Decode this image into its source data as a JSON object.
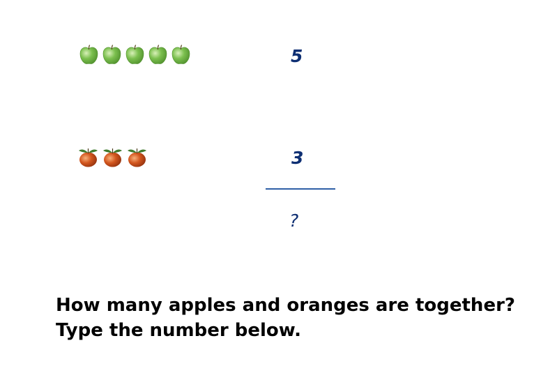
{
  "problem": {
    "apples": {
      "count": 5,
      "icon": "green-apple-icon",
      "number_label": "5",
      "colors": {
        "body": "#7cc04f",
        "shade": "#4f8f2c"
      }
    },
    "oranges": {
      "count": 3,
      "icon": "orange-fruit-icon",
      "number_label": "3",
      "colors": {
        "body": "#d2561e",
        "shade": "#8a2d0c",
        "leaf": "#3f7a2c"
      }
    },
    "result_label": "?",
    "number_color": "#0e2f73",
    "line_color": "#2f5fa6"
  },
  "question": {
    "line1": "How many apples and oranges are together?",
    "line2": "Type the number below."
  }
}
